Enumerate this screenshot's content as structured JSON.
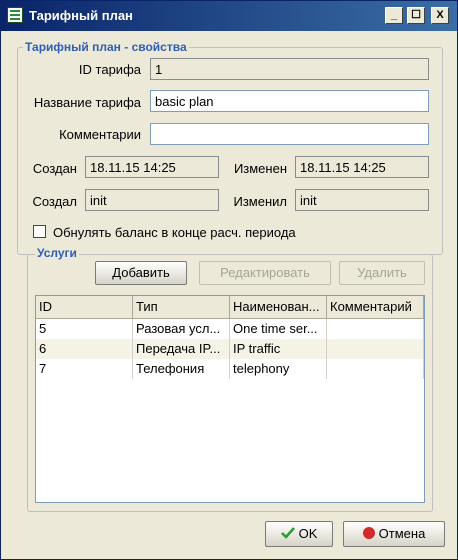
{
  "window": {
    "title": "Тарифный план",
    "min": "_",
    "max": "☐",
    "close": "X"
  },
  "props": {
    "legend": "Тарифный план - свойства",
    "id_label": "ID тарифа",
    "id_value": "1",
    "name_label": "Название тарифа",
    "name_value": "basic plan",
    "comment_label": "Комментарии",
    "comment_value": "",
    "created_label": "Создан",
    "created_value": "18.11.15 14:25",
    "modified_label": "Изменен",
    "modified_value": "18.11.15 14:25",
    "creator_label": "Создал",
    "creator_value": "init",
    "modifier_label": "Изменил",
    "modifier_value": "init",
    "reset_balance_label": "Обнулять баланс в конце расч. периода",
    "reset_balance_checked": false
  },
  "services": {
    "legend": "Услуги",
    "add_label": "Добавить",
    "edit_label": "Редактировать",
    "delete_label": "Удалить",
    "columns": [
      "ID",
      "Тип",
      "Наименован...",
      "Комментарий"
    ],
    "rows": [
      [
        "5",
        "Разовая усл...",
        "One time ser...",
        ""
      ],
      [
        "6",
        "Передача IP...",
        "IP traffic",
        ""
      ],
      [
        "7",
        "Телефония",
        "telephony",
        ""
      ]
    ]
  },
  "footer": {
    "ok_label": "OK",
    "cancel_label": "Отмена"
  }
}
